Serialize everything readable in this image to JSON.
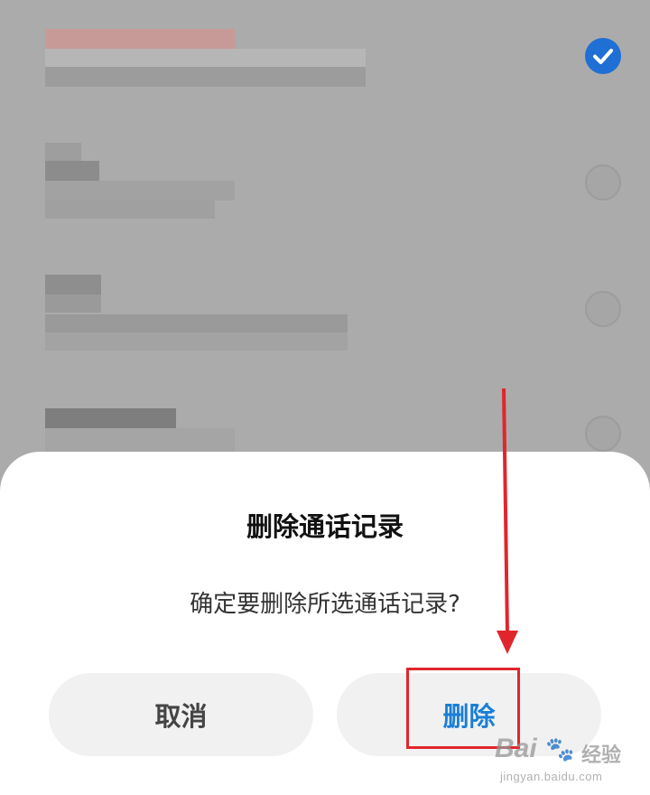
{
  "dialog": {
    "title": "删除通话记录",
    "message": "确定要删除所选通话记录?",
    "cancel_label": "取消",
    "confirm_label": "删除"
  },
  "call_list": {
    "items": [
      {
        "selected": true
      },
      {
        "selected": false
      },
      {
        "selected": false
      },
      {
        "selected": false
      }
    ]
  },
  "watermark": {
    "brand": "Bai",
    "brand_suffix": "经验",
    "url": "jingyan.baidu.com"
  },
  "colors": {
    "accent": "#1a7fd6",
    "check_selected": "#1f6fd4",
    "annotation": "#e0262c",
    "overlay": "#ababab"
  }
}
